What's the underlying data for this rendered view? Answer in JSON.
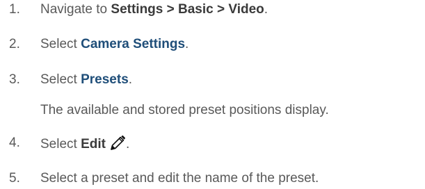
{
  "steps": [
    {
      "number": "1.",
      "parts": [
        "Navigate to ",
        "Settings > Basic > Video",
        "."
      ]
    },
    {
      "number": "2.",
      "parts": [
        "Select ",
        "Camera Settings",
        "."
      ]
    },
    {
      "number": "3.",
      "parts": [
        "Select ",
        "Presets",
        "."
      ],
      "note": "The available and stored preset positions display."
    },
    {
      "number": "4.",
      "parts": [
        "Select ",
        "Edit",
        "."
      ],
      "icon": "pencil-edit-icon"
    },
    {
      "number": "5.",
      "text": "Select a preset and edit the name of the preset."
    }
  ],
  "colors": {
    "body_text": "#595959",
    "bold_text": "#3a3a3a",
    "link_text": "#1f4e79"
  }
}
